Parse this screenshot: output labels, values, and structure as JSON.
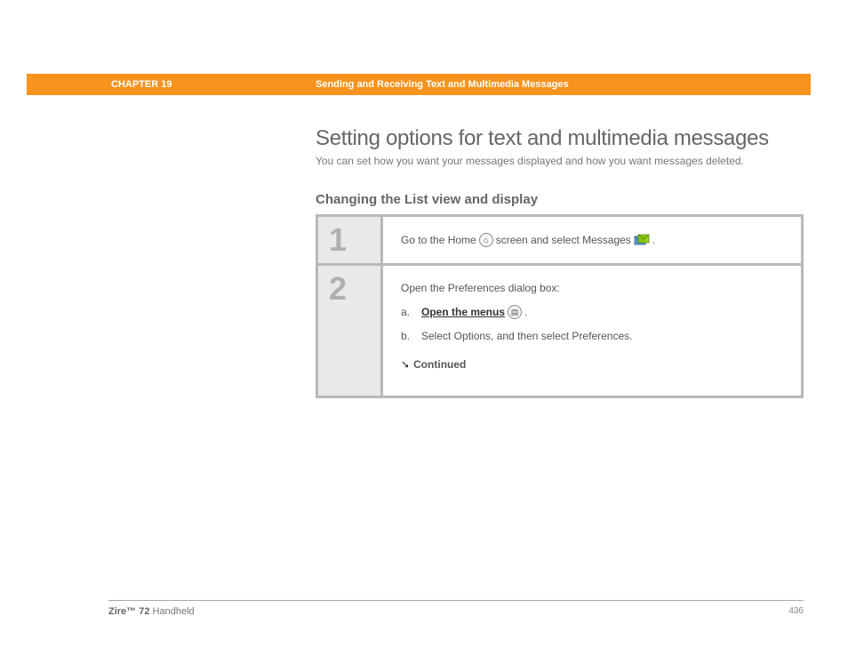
{
  "header": {
    "chapter": "CHAPTER 19",
    "title": "Sending and Receiving Text and Multimedia Messages"
  },
  "section": {
    "title": "Setting options for text and multimedia messages",
    "subtitle": "You can set how you want your messages displayed and how you want messages deleted.",
    "subsection": "Changing the List view and display"
  },
  "steps": [
    {
      "number": "1",
      "text_before_icon1": "Go to the Home",
      "text_mid": "screen and select Messages",
      "text_after": "."
    },
    {
      "number": "2",
      "intro": "Open the Preferences dialog box:",
      "sub_a_letter": "a.",
      "sub_a_link": "Open the menus",
      "sub_a_after": ".",
      "sub_b_letter": "b.",
      "sub_b_text": "Select Options, and then select Preferences.",
      "continued": "Continued"
    }
  ],
  "footer": {
    "product_bold": "Zire™ 72",
    "product_rest": "Handheld",
    "page": "436"
  }
}
